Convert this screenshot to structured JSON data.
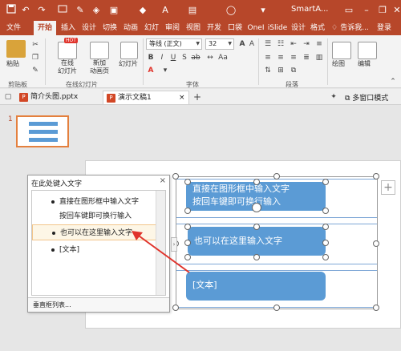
{
  "titlebar": {
    "title": "SmartA...",
    "qat_icons": [
      "save-icon",
      "undo-icon",
      "redo-icon",
      "start-from-beginning-icon",
      "format-painter-icon",
      "shape-fill-icon",
      "font-color-icon",
      "picture-icon",
      "circle-icon",
      "customize-qat-icon"
    ],
    "win_minimize": "–",
    "win_restore": "❐",
    "win_close": "✕"
  },
  "tabs": [
    "文件",
    "开始",
    "插入",
    "设计",
    "切换",
    "动画",
    "幻灯",
    "审阅",
    "视图",
    "开发",
    "口袋",
    "OneI",
    "iSlide",
    "设计",
    "格式"
  ],
  "active_tab": "开始",
  "tell_me": "告诉我...",
  "login": "登录",
  "ribbon": {
    "paste": "粘贴",
    "clipboard_group": "剪贴板",
    "new_slide_online": "在线\n幻灯片",
    "new_slide": "新加\n动画页",
    "slides_btn": "幻灯片",
    "hot_badge": "HOT",
    "online_group": "在线幻灯片",
    "font_name": "等线 (正文)",
    "font_size": "32",
    "font_group": "字体",
    "paragraph_group": "段落",
    "drawing": "绘图",
    "editing": "编辑",
    "drawing_group": ""
  },
  "doc_tabs": [
    {
      "label": "简介头图.pptx",
      "active": false
    },
    {
      "label": "演示文稿1",
      "active": true,
      "close": "×"
    }
  ],
  "doc_tabs_right": {
    "multi_window": "多窗口模式"
  },
  "thumbnail": {
    "number": "1"
  },
  "textpane": {
    "title": "在此处键入文字",
    "close": "×",
    "items": [
      {
        "text": "直接在图形框中输入文字"
      },
      {
        "text": "按回车键即可换行输入"
      },
      {
        "text": "也可以在这里输入文字"
      },
      {
        "text": "[文本]"
      }
    ],
    "footer": "垂直框列表..."
  },
  "smartart": {
    "boxes": [
      {
        "line1": "直接在图形框中输入文字",
        "line2": "按回车键即可换行输入"
      },
      {
        "line1": "也可以在这里输入文字"
      },
      {
        "line1": "[文本]"
      }
    ],
    "plus": "+"
  },
  "colors": {
    "accent": "#b7472a",
    "shape_fill": "#5b9bd5",
    "arrow": "#e0332b"
  }
}
